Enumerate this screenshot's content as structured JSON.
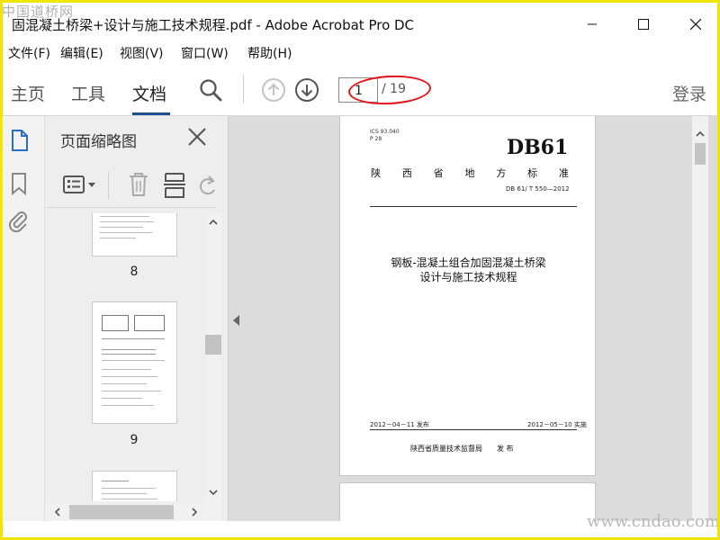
{
  "watermark": {
    "top_left": "中国道桥网",
    "bottom_right": "www.cndao.com"
  },
  "window": {
    "title": "固混凝土桥梁+设计与施工技术规程.pdf - Adobe Acrobat Pro DC",
    "minimize": "—",
    "maximize": "☐",
    "close": "✕"
  },
  "menu": [
    "文件(F)",
    "编辑(E)",
    "视图(V)",
    "窗口(W)",
    "帮助(H)"
  ],
  "toolbar": {
    "tabs": [
      "主页",
      "工具",
      "文档"
    ],
    "active_tab": "文档",
    "page_current": "1",
    "page_total": "/ 19",
    "login": "登录"
  },
  "thumbnails_pane": {
    "title": "页面缩略图",
    "pages": [
      {
        "label": "8"
      },
      {
        "label": "9"
      }
    ]
  },
  "document": {
    "ics": "ICS 93.040",
    "cls": "P 28",
    "code": "DB61",
    "province_chars": [
      "陕",
      "西",
      "省",
      "地",
      "方",
      "标",
      "准"
    ],
    "std_no": "DB 61/ T 550—2012",
    "title_line1": "钢板-混凝土组合加固混凝土桥梁",
    "title_line2": "设计与施工技术规程",
    "issue_date": "2012－04－11 发布",
    "impl_date": "2012－05－10 实施",
    "publisher": "陕西省质量技术监督局　　发 布"
  },
  "colors": {
    "accent": "#1d4f91",
    "annotation": "#e0161b",
    "frame": "#f0e600",
    "doc_bg": "#dcdcdc",
    "icon_blue": "#2a6fc7"
  },
  "icons": [
    "search-icon",
    "page-up-icon",
    "page-down-icon",
    "page-thumbnails-icon",
    "bookmark-icon",
    "attachment-icon",
    "options-menu-icon",
    "delete-icon",
    "insert-page-icon",
    "rotate-icon"
  ]
}
